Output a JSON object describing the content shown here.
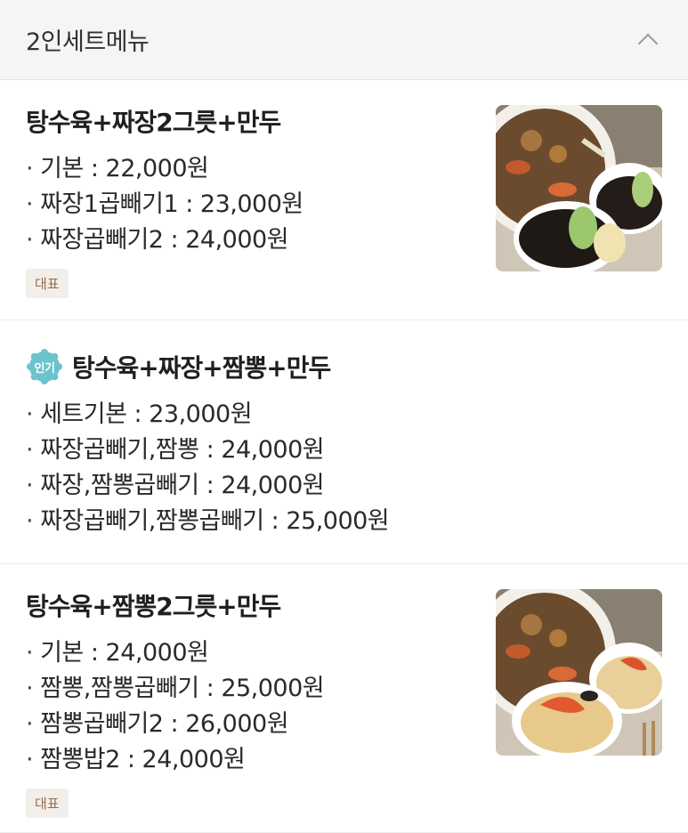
{
  "header": {
    "title": "2인세트메뉴"
  },
  "menu_items": [
    {
      "title": "탕수육+짜장2그릇+만두",
      "prices": [
        "기본 : 22,000원",
        "짜장1곱빼기1 : 23,000원",
        "짜장곱빼기2 : 24,000원"
      ],
      "badge": "대표"
    },
    {
      "popular_label": "인기",
      "title": "탕수육+짜장+짬뽕+만두",
      "prices": [
        "세트기본 : 23,000원",
        "짜장곱빼기,짬뽕 : 24,000원",
        "짜장,짬뽕곱빼기 : 24,000원",
        "짜장곱빼기,짬뽕곱빼기 : 25,000원"
      ]
    },
    {
      "title": "탕수육+짬뽕2그릇+만두",
      "prices": [
        "기본 : 24,000원",
        "짬뽕,짬뽕곱빼기 : 25,000원",
        "짬뽕곱빼기2 : 26,000원",
        "짬뽕밥2 : 24,000원"
      ],
      "badge": "대표"
    }
  ],
  "colors": {
    "header_bg": "#f5f5f5",
    "badge_bg": "#f2efea",
    "badge_text": "#9a6b48",
    "popular_badge": "#6cc3cb"
  },
  "icons": {
    "collapse": "chevron-up-icon",
    "popular": "popular-badge-icon"
  }
}
